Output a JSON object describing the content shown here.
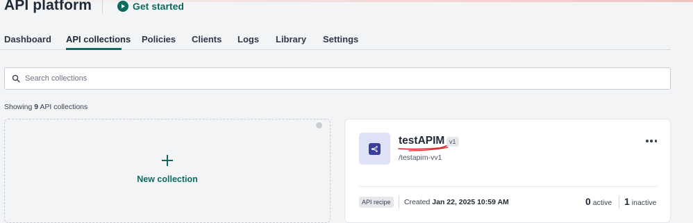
{
  "header": {
    "title": "API platform",
    "get_started_label": "Get started"
  },
  "tabs": [
    {
      "label": "Dashboard",
      "active": false
    },
    {
      "label": "API collections",
      "active": true
    },
    {
      "label": "Policies",
      "active": false
    },
    {
      "label": "Clients",
      "active": false
    },
    {
      "label": "Logs",
      "active": false
    },
    {
      "label": "Library",
      "active": false
    },
    {
      "label": "Settings",
      "active": false
    }
  ],
  "search": {
    "placeholder": "Search collections",
    "value": ""
  },
  "summary": {
    "prefix": "Showing",
    "count": "9",
    "suffix": "API collections"
  },
  "new_collection": {
    "label": "New collection"
  },
  "collection": {
    "name": "testAPIM",
    "version": "v1",
    "path": "/testapim-vv1",
    "recipe_badge": "API recipe",
    "created_prefix": "Created",
    "created_date": "Jan 22, 2025 10:59 AM",
    "active_count": "0",
    "active_label": "active",
    "inactive_count": "1",
    "inactive_label": "inactive"
  },
  "colors": {
    "accent": "#0c6b5e",
    "icon_bg": "#dfe1f6",
    "icon_fg": "#3b3f9a",
    "annotation_red": "#e02020"
  },
  "icons": {
    "get_started": "play-circle-icon",
    "search": "search-icon",
    "new_collection": "plus-icon",
    "collection": "api-collection-icon",
    "menu": "more-horizontal-icon"
  }
}
